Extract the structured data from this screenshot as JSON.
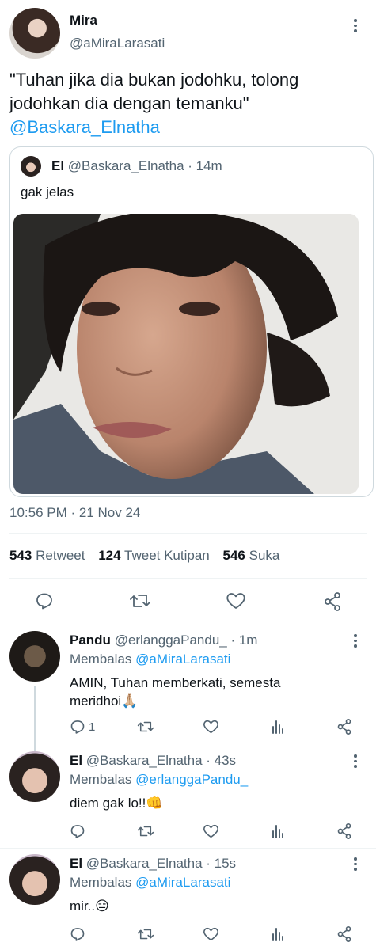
{
  "main_tweet": {
    "author_name": "Mira",
    "author_handle": "@aMiraLarasati",
    "text": "\"Tuhan jika dia bukan jodohku, tolong jodohkan dia dengan temanku\"",
    "mention": "@Baskara_Elnatha",
    "timestamp": "10:56 PM · 21 Nov 24",
    "stats": {
      "retweet_count": "543",
      "retweet_label": "Retweet",
      "quote_count": "124",
      "quote_label": "Tweet Kutipan",
      "like_count": "546",
      "like_label": "Suka"
    }
  },
  "quoted_tweet": {
    "author_name": "El",
    "author_handle": "@Baskara_Elnatha",
    "time": "· 14m",
    "text": "gak jelas"
  },
  "replies": [
    {
      "author_name": "Pandu",
      "author_handle": "@erlanggaPandu_",
      "time": "· 1m",
      "replying_label": "Membalas",
      "replying_to": "@aMiraLarasati",
      "text_line1": "AMIN, Tuhan memberkati, semesta",
      "text_line2": "meridhoi🙏🏼",
      "reply_count": "1"
    },
    {
      "author_name": "El",
      "author_handle": "@Baskara_Elnatha",
      "time": "· 43s",
      "replying_label": "Membalas",
      "replying_to": "@erlanggaPandu_",
      "text_line1": "diem gak lo!!👊",
      "reply_count": ""
    },
    {
      "author_name": "El",
      "author_handle": "@Baskara_Elnatha",
      "time": "· 15s",
      "replying_label": "Membalas",
      "replying_to": "@aMiraLarasati",
      "text_line1": "mir..😑",
      "reply_count": ""
    }
  ],
  "colors": {
    "accent": "#1d9bf0",
    "text": "#0f1419",
    "secondary": "#536471",
    "divider": "#eff3f4"
  }
}
